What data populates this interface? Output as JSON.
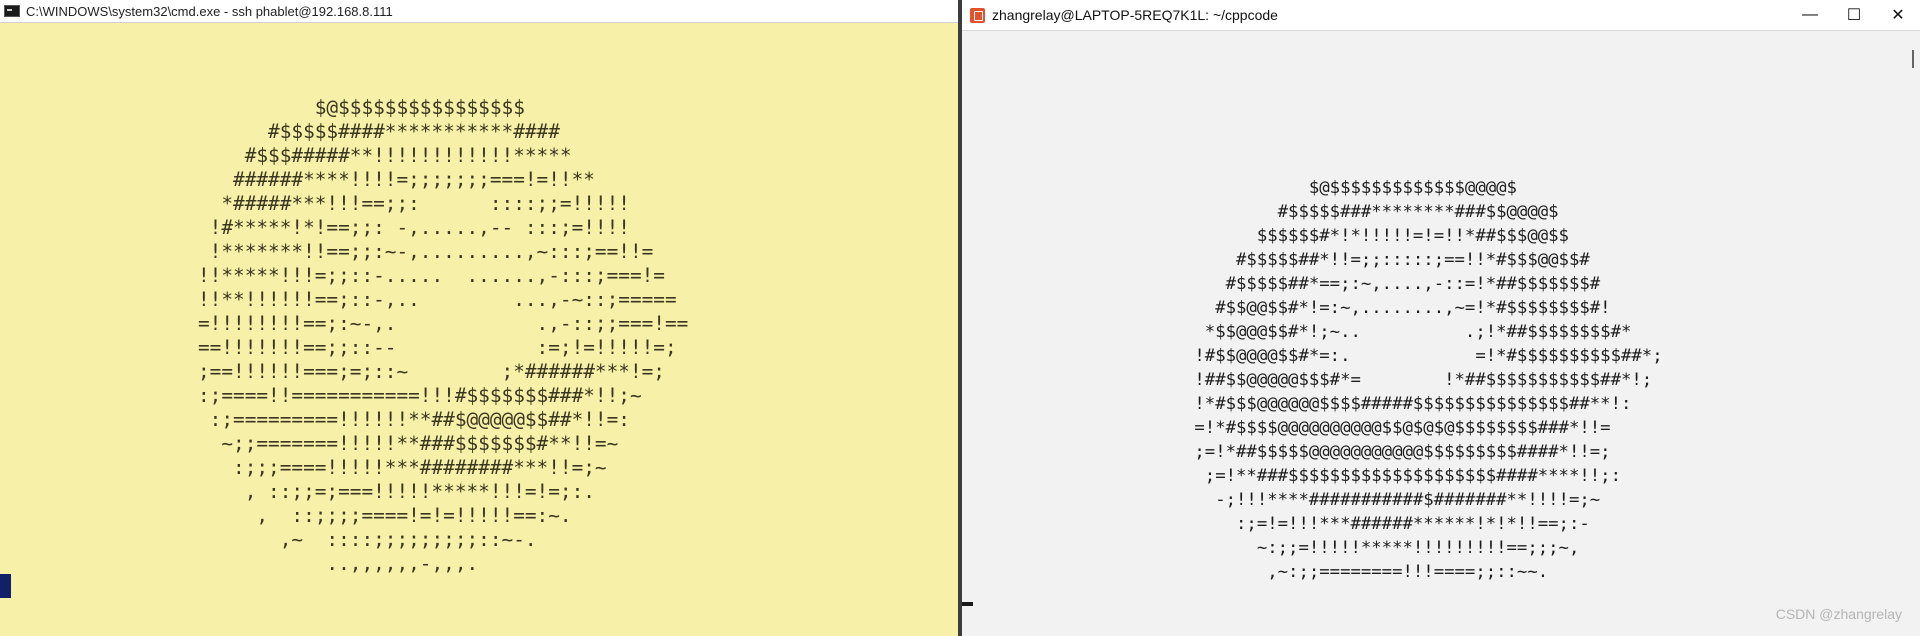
{
  "left_window": {
    "title": "C:\\WINDOWS\\system32\\cmd.exe - ssh  phablet@192.168.8.111",
    "icon": "cmd-icon",
    "bg_color": "#f7f0a8",
    "ascii_art": "          $@$$$$$$$$$$$$$$$$\n      #$$$$$####***********####\n    #$$$#####**!!!!!!!!!!!!*****\n   ######****!!!!=;;;;;;;===!=!!**\n  *#####***!!!==;;:      ::::;;=!!!!!\n !#*****!*!==;;: -,.....,-- :::;=!!!!\n !*******!!==;;:~-,.........,~:::;==!!=\n!!*****!!!=;;::-.....  ......,-:::;===!=\n!!**!!!!!!==;::-,..        ...,-~::;=====\n=!!!!!!!!==;:~-,.            .,-::;;===!==\n==!!!!!!!==;;::--            :=;!=!!!!!=;\n;==!!!!!!===;=;::~        ;*######***!=;\n:;====!!===========!!!#$$$$$$$###*!!;~\n :;=========!!!!!!**##$@@@@@$$##*!!=:\n  ~;;=======!!!!!**###$$$$$$$#**!!=~\n   :;;;====!!!!!***########***!!=;~\n    , ::;;=;===!!!!!*****!!!=!=;:.\n     ,  ::;;;;====!=!=!!!!!==:~.\n       ,~  ::::;;;;;;;;;::~-.\n           ..,,,,,,-,,,.",
    "cursor": "cursor-block"
  },
  "right_window": {
    "title": "zhangrelay@LAPTOP-5REQ7K1L: ~/cppcode",
    "icon": "terminal-app-icon",
    "bg_color": "#f2f2f2",
    "controls": {
      "minimize": "—",
      "maximize": "☐",
      "close": "✕"
    },
    "ascii_art": "            $@$$$$$$$$$$$$$@@@@$\n         #$$$$$###********###$$@@@@$\n       $$$$$$#*!*!!!!!=!=!!*##$$$@@$$\n     #$$$$$##*!!=;;:::::;==!!*#$$$@@$$#\n    #$$$$$##*==;:~,....,-::=!*##$$$$$$$#\n   #$$@@$$#*!=:~,........,~=!*#$$$$$$$$#!\n  *$$@@@$$#*!;~..          .;!*##$$$$$$$$#*\n !#$$@@@@$$#*=:.            =!*#$$$$$$$$$$##*;\n !##$$@@@@@$$$#*=        !*##$$$$$$$$$$$##*!;\n !*#$$$@@@@@@$$$$#####$$$$$$$$$$$$$$$##**!:\n =!*#$$$$@@@@@@@@@@$$@$@$@$$$$$$$$###*!!=\n ;=!*##$$$$$@@@@@@@@@@@$$$$$$$$$####*!!=;\n  ;=!**###$$$$$$$$$$$$$$$$$$$$####****!!;:\n   -;!!!****###########$#######**!!!!=;~\n     :;=!=!!!***######******!*!*!!==;:-\n       ~:;;=!!!!!*****!!!!!!!!!==;;;~,\n        ,~:;;========!!!====;;::~~.",
    "cursor": "cursor-underline"
  },
  "watermark": "CSDN @zhangrelay"
}
